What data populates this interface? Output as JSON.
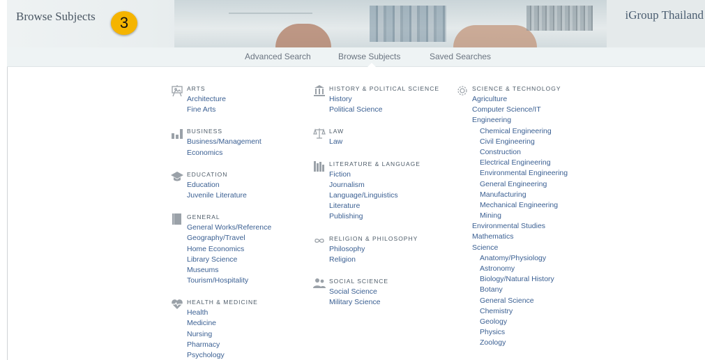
{
  "header": {
    "title": "Browse Subjects",
    "step_badge": "3",
    "brand": "iGroup Thailand"
  },
  "nav": {
    "advanced": "Advanced Search",
    "browse": "Browse Subjects",
    "saved": "Saved Searches"
  },
  "columns": [
    [
      {
        "title": "ARTS",
        "icon": "easel-icon",
        "items": [
          "Architecture",
          "Fine Arts"
        ]
      },
      {
        "title": "BUSINESS",
        "icon": "bar-chart-icon",
        "items": [
          "Business/Management",
          "Economics"
        ]
      },
      {
        "title": "EDUCATION",
        "icon": "graduation-cap-icon",
        "items": [
          "Education",
          "Juvenile Literature"
        ]
      },
      {
        "title": "GENERAL",
        "icon": "book-icon",
        "items": [
          "General Works/Reference",
          "Geography/Travel",
          "Home Economics",
          "Library Science",
          "Museums",
          "Tourism/Hospitality"
        ]
      },
      {
        "title": "HEALTH & MEDICINE",
        "icon": "heart-pulse-icon",
        "items": [
          "Health",
          "Medicine",
          "Nursing",
          "Pharmacy",
          "Psychology"
        ]
      }
    ],
    [
      {
        "title": "HISTORY & POLITICAL SCIENCE",
        "icon": "building-icon",
        "items": [
          "History",
          "Political Science"
        ]
      },
      {
        "title": "LAW",
        "icon": "scales-icon",
        "items": [
          "Law"
        ]
      },
      {
        "title": "LITERATURE & LANGUAGE",
        "icon": "books-icon",
        "items": [
          "Fiction",
          "Journalism",
          "Language/Linguistics",
          "Literature",
          "Publishing"
        ]
      },
      {
        "title": "RELIGION & PHILOSOPHY",
        "icon": "infinity-icon",
        "items": [
          "Philosophy",
          "Religion"
        ]
      },
      {
        "title": "SOCIAL SCIENCE",
        "icon": "people-icon",
        "items": [
          "Social Science",
          "Military Science"
        ]
      }
    ],
    [
      {
        "title": "SCIENCE & TECHNOLOGY",
        "icon": "gear-icon",
        "items": [
          {
            "label": "Agriculture",
            "sub": false
          },
          {
            "label": "Computer Science/IT",
            "sub": false
          },
          {
            "label": "Engineering",
            "sub": false
          },
          {
            "label": "Chemical Engineering",
            "sub": true
          },
          {
            "label": "Civil Engineering",
            "sub": true
          },
          {
            "label": "Construction",
            "sub": true
          },
          {
            "label": "Electrical Engineering",
            "sub": true
          },
          {
            "label": "Environmental Engineering",
            "sub": true
          },
          {
            "label": "General Engineering",
            "sub": true
          },
          {
            "label": "Manufacturing",
            "sub": true
          },
          {
            "label": "Mechanical Engineering",
            "sub": true
          },
          {
            "label": "Mining",
            "sub": true
          },
          {
            "label": "Environmental Studies",
            "sub": false
          },
          {
            "label": "Mathematics",
            "sub": false
          },
          {
            "label": "Science",
            "sub": false
          },
          {
            "label": "Anatomy/Physiology",
            "sub": true
          },
          {
            "label": "Astronomy",
            "sub": true
          },
          {
            "label": "Biology/Natural History",
            "sub": true
          },
          {
            "label": "Botany",
            "sub": true
          },
          {
            "label": "General Science",
            "sub": true
          },
          {
            "label": "Chemistry",
            "sub": true
          },
          {
            "label": "Geology",
            "sub": true
          },
          {
            "label": "Physics",
            "sub": true
          },
          {
            "label": "Zoology",
            "sub": true
          }
        ]
      }
    ]
  ]
}
